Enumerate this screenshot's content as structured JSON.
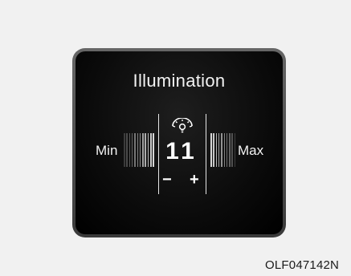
{
  "screen": {
    "title": "Illumination",
    "min_label": "Min",
    "max_label": "Max",
    "value": "11",
    "minus_label": "−",
    "plus_label": "+",
    "icon": "dashboard-illumination-icon"
  },
  "figure_code": "OLF047142N",
  "colors": {
    "page_background": "#f1f1f1",
    "screen_background": "#000000",
    "text": "#ffffff"
  }
}
